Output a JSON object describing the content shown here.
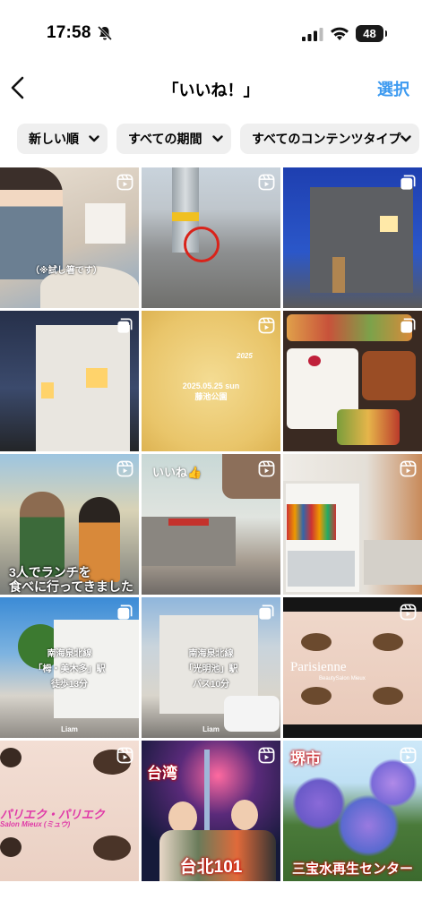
{
  "status_bar": {
    "time": "17:58",
    "battery": "48"
  },
  "header": {
    "title": "「いいね！」",
    "select_label": "選択"
  },
  "filters": [
    {
      "label": "新しい順"
    },
    {
      "label": "すべての期間"
    },
    {
      "label": "すべてのコンテンツタイプ"
    }
  ],
  "posts": [
    {
      "badge": "reels-icon",
      "overlay": "（※試し箸です）"
    },
    {
      "badge": "reels-icon",
      "overlay": ""
    },
    {
      "badge": "carousel-icon",
      "overlay": ""
    },
    {
      "badge": "carousel-icon",
      "overlay": ""
    },
    {
      "badge": "reels-icon",
      "overlay": "2025.05.25 sun\n藤池公園",
      "overlay2": "2025"
    },
    {
      "badge": "carousel-icon",
      "overlay": ""
    },
    {
      "badge": "reels-icon",
      "overlay": "3人でランチを\n食べに行ってきました"
    },
    {
      "badge": "reels-icon",
      "overlay": "いいね👍"
    },
    {
      "badge": "reels-icon",
      "overlay": ""
    },
    {
      "badge": "carousel-icon",
      "overlay": "南海泉北線\n「栂・美木多」駅\n徒歩13分",
      "overlay2": "Liam"
    },
    {
      "badge": "carousel-icon",
      "overlay": "南海泉北線\n「光明池」駅\nバス10分",
      "overlay2": "Liam"
    },
    {
      "badge": "reels-icon",
      "overlay": "Parisienne",
      "overlay2": "BeautySalon Mieux"
    },
    {
      "badge": "reels-icon",
      "overlay": "パリエク・パリエク",
      "overlay2": "Salon Mieux (ミュウ)"
    },
    {
      "badge": "reels-icon",
      "overlay": "台湾",
      "overlay2": "台北101"
    },
    {
      "badge": "reels-icon",
      "overlay": "堺市",
      "overlay2": "三宝水再生センター"
    }
  ]
}
